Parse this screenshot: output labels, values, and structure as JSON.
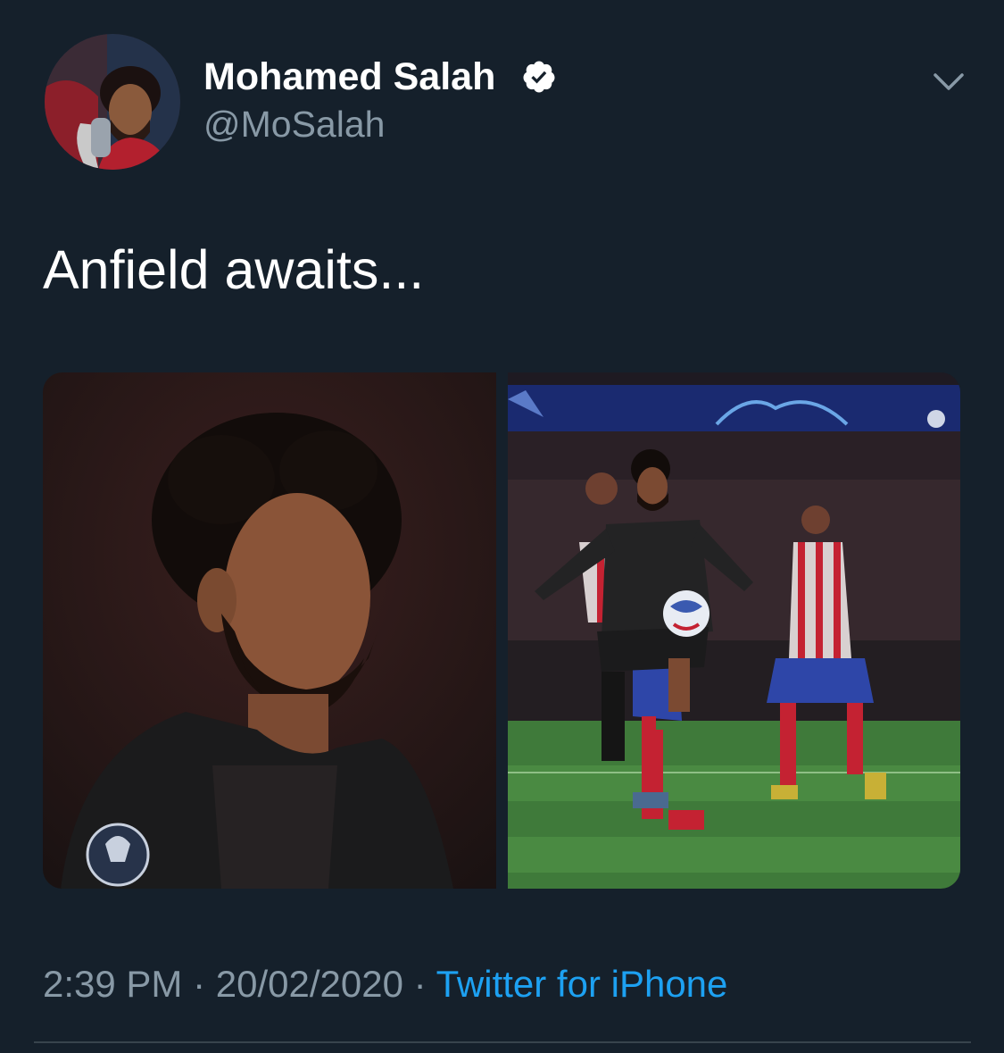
{
  "tweet": {
    "author": {
      "display_name": "Mohamed Salah",
      "handle": "@MoSalah",
      "verified": true,
      "avatar_icon": "profile-photo"
    },
    "text": "Anfield awaits...",
    "media": [
      {
        "type": "photo",
        "icon": "player-portrait-photo"
      },
      {
        "type": "photo",
        "icon": "match-action-photo"
      }
    ],
    "time": "2:39 PM",
    "separator": "·",
    "date": "20/02/2020",
    "source": "Twitter for iPhone",
    "menu_icon": "chevron-down-icon"
  },
  "theme": {
    "background": "#15202b",
    "text_primary": "#ffffff",
    "text_secondary": "#8899a6",
    "link": "#1da1f2",
    "divider": "#38444d"
  }
}
